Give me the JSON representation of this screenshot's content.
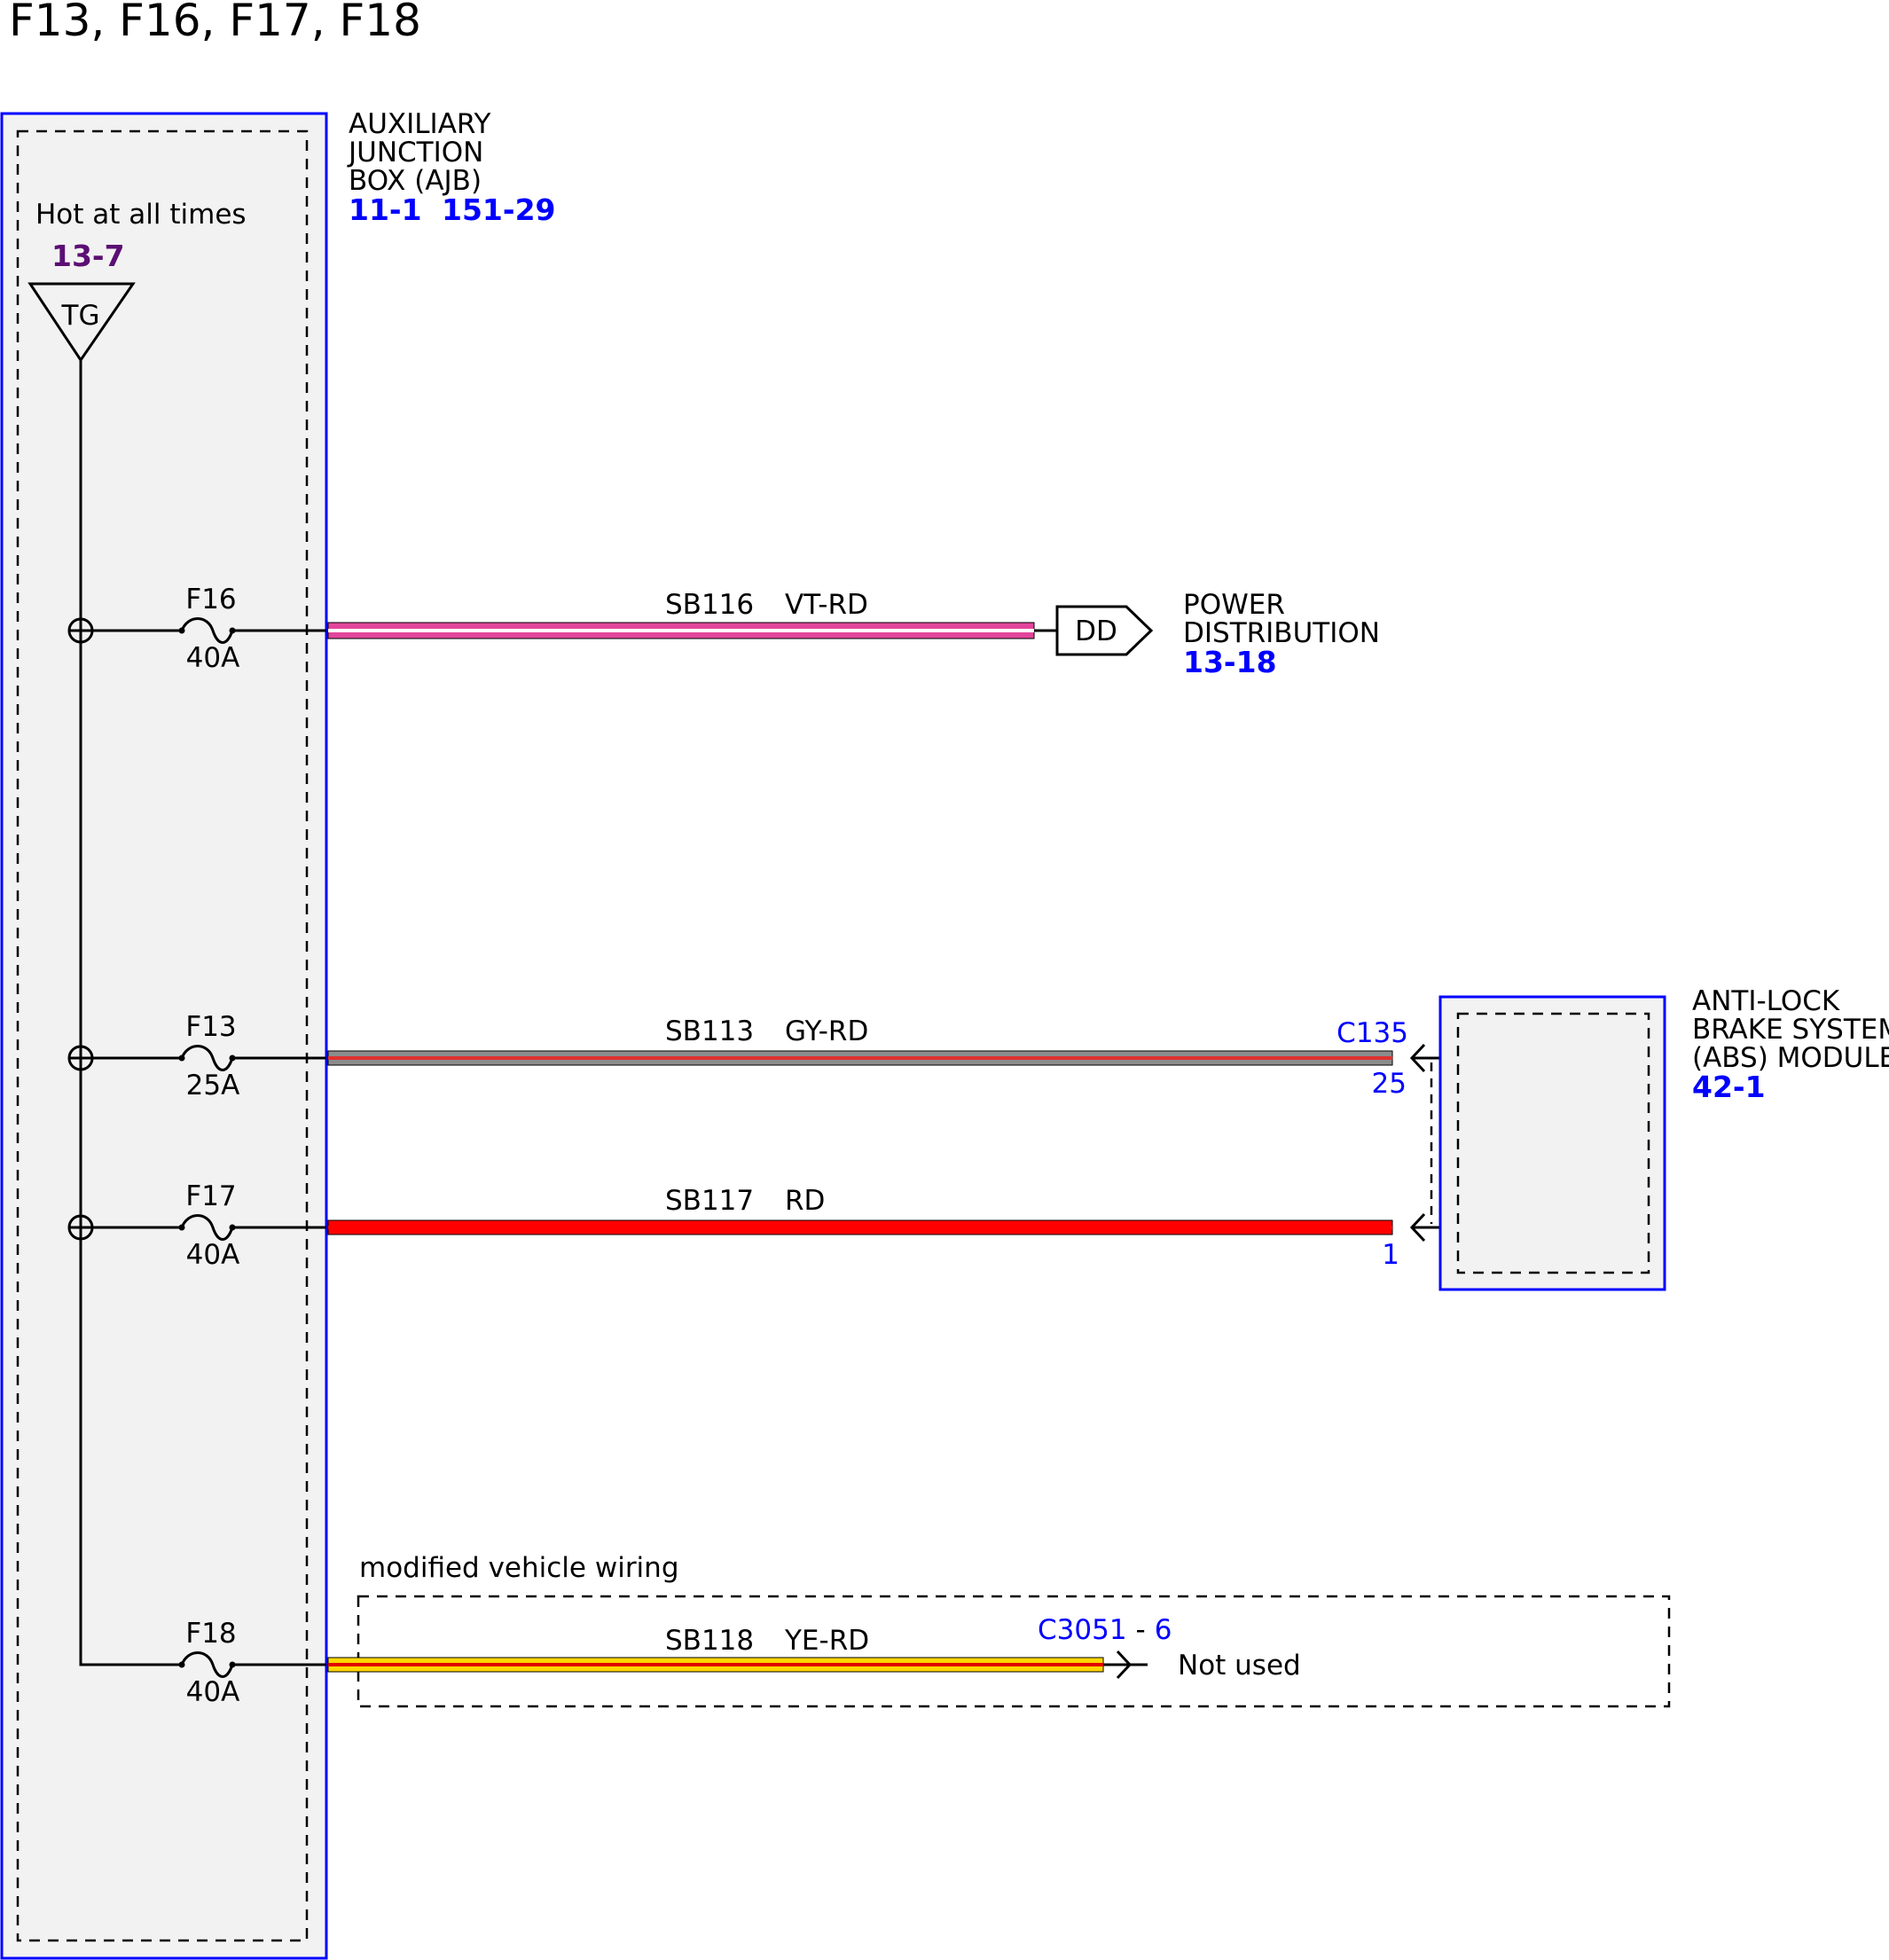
{
  "title": "F13, F16, F17, F18",
  "junction_box": {
    "name_lines": [
      "AUXILIARY",
      "JUNCTION",
      "BOX (AJB)"
    ],
    "ref_a": "11-1",
    "ref_b": "151-29",
    "hot_label": "Hot at all times",
    "hot_ref": "13-7",
    "bus_label": "TG"
  },
  "fuses": [
    {
      "id": "F16",
      "rating": "40A"
    },
    {
      "id": "F13",
      "rating": "25A"
    },
    {
      "id": "F17",
      "rating": "40A"
    },
    {
      "id": "F18",
      "rating": "40A"
    }
  ],
  "wires": [
    {
      "circuit": "SB116",
      "color_code": "VT-RD",
      "base_color": "#e2459b",
      "stripe_color": "#ffffff"
    },
    {
      "circuit": "SB113",
      "color_code": "GY-RD",
      "base_color": "#8c8c8c",
      "stripe_color": "#e03030"
    },
    {
      "circuit": "SB117",
      "color_code": "RD",
      "base_color": "#ff0000",
      "stripe_color": "#ff0000"
    },
    {
      "circuit": "SB118",
      "color_code": "YE-RD",
      "base_color": "#ffd800",
      "stripe_color": "#e00000"
    }
  ],
  "power_distribution": {
    "connector": "DD",
    "name_lines": [
      "POWER",
      "DISTRIBUTION"
    ],
    "ref": "13-18"
  },
  "abs_module": {
    "name_lines": [
      "ANTI-LOCK",
      "BRAKE SYSTEM",
      "(ABS) MODULE"
    ],
    "ref": "42-1",
    "connector": "C135",
    "pin_a": "25",
    "pin_b": "1"
  },
  "modified_wiring": {
    "label": "modified vehicle wiring",
    "connector": "C3051",
    "separator": "-",
    "pin": "6",
    "note": "Not used"
  },
  "colors": {
    "module_border": "#0000ff",
    "module_fill": "#f2f2f2",
    "ref_text": "#0000ff",
    "hot_ref_text": "#5b0f73"
  }
}
